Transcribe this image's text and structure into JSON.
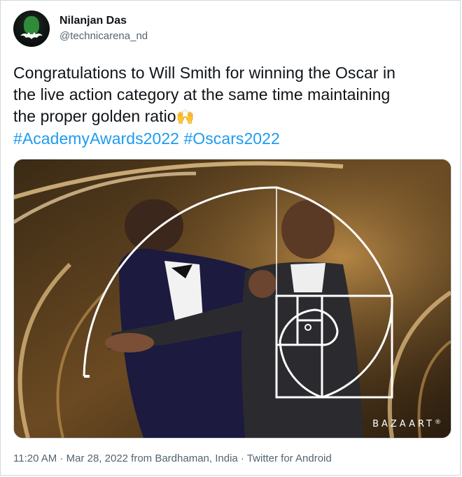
{
  "author": {
    "display_name": "Nilanjan Das",
    "handle": "@technicarena_nd",
    "avatar_icon": "batman-avatar-icon"
  },
  "tweet": {
    "text_line_1": "Congratulations to Will Smith for winning the Oscar in",
    "text_line_2": "the live action category at the same time maintaining",
    "text_line_3": "the proper golden ratio",
    "emoji": "🙌",
    "hashtag_1": "#AcademyAwards2022",
    "hashtag_2": "#Oscars2022"
  },
  "media": {
    "watermark": "BAZAART",
    "watermark_mark": "®",
    "overlay": "golden-spiral"
  },
  "meta": {
    "time": "11:20 AM",
    "date": "Mar 28, 2022",
    "location": "from Bardhaman, India",
    "client": "Twitter for Android",
    "separator": "·"
  },
  "colors": {
    "link": "#1d9bf0",
    "secondary_text": "#536471",
    "border": "#cfd9de"
  }
}
